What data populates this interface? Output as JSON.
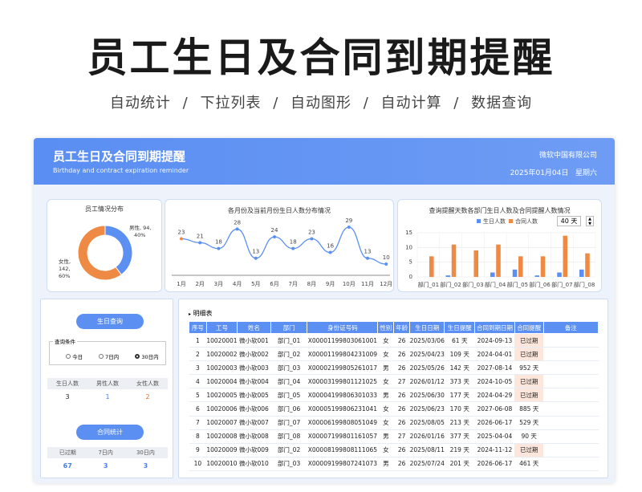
{
  "hero": {
    "title": "员工生日及合同到期提醒",
    "features": [
      "自动统计",
      "下拉列表",
      "自动图形",
      "自动计算",
      "数据查询"
    ],
    "sep": "/"
  },
  "banner": {
    "title": "员工生日及合同到期提醒",
    "subtitle": "Birthday and contract expiration reminder",
    "company": "微软中国有限公司",
    "date": "2025年01月04日",
    "weekday": "星期六"
  },
  "donut": {
    "title": "员工情况分布",
    "male_label": "男性, 94, 40%",
    "female_label": "女性, 142, 60%",
    "male": 94,
    "female": 142,
    "colors": {
      "male": "#5b8ff2",
      "female": "#ef8a45"
    }
  },
  "chart_data": [
    {
      "type": "line",
      "title": "各月份及当前月份生日人数分布情况",
      "categories": [
        "1月",
        "2月",
        "3月",
        "4月",
        "5月",
        "6月",
        "7月",
        "8月",
        "9月",
        "10月",
        "11月",
        "12月"
      ],
      "values": [
        23,
        21,
        18,
        28,
        13,
        24,
        18,
        23,
        16,
        29,
        13,
        10
      ],
      "highlight_index": 0
    },
    {
      "type": "bar",
      "title": "查询提醒天数各部门生日人数及合同提醒人数情况",
      "categories": [
        "部门_01",
        "部门_02",
        "部门_03",
        "部门_04",
        "部门_05",
        "部门_06",
        "部门_07",
        "部门_08"
      ],
      "series": [
        {
          "name": "生日人数",
          "values": [
            0,
            0.5,
            0,
            1.5,
            2.5,
            0.5,
            1.5,
            2.5
          ]
        },
        {
          "name": "合同人数",
          "values": [
            7,
            11,
            9,
            11,
            7,
            7,
            14,
            8
          ]
        }
      ],
      "yticks": [
        0,
        5,
        10,
        15
      ],
      "ylim": [
        0,
        15
      ],
      "legend": "top"
    }
  ],
  "query": {
    "days": "40 天"
  },
  "birthday": {
    "button": "生日查询",
    "group_label": "查询条件",
    "options": [
      "今日",
      "7日内",
      "30日内"
    ],
    "selected": 2,
    "headers": [
      "生日人数",
      "男性人数",
      "女性人数"
    ],
    "values": [
      "3",
      "1",
      "2"
    ]
  },
  "contract": {
    "button": "合同统计",
    "headers": [
      "已过期",
      "7日内",
      "30日内"
    ],
    "values": [
      "67",
      "3",
      "3"
    ]
  },
  "detail": {
    "title": "明细表",
    "headers": [
      "序号",
      "工号",
      "姓名",
      "部门",
      "身份证号码",
      "性别",
      "年龄",
      "生日日期",
      "生日提醒",
      "合同到期日期",
      "合同提醒",
      "备注"
    ],
    "rows": [
      [
        "1",
        "10020001",
        "微小软001",
        "部门_01",
        "X00001199803061001",
        "女",
        "26",
        "2025/03/06",
        "61 天",
        "2024-09-13",
        "已过期",
        ""
      ],
      [
        "2",
        "10020002",
        "微小软002",
        "部门_02",
        "X00001199804231009",
        "女",
        "26",
        "2025/04/23",
        "109 天",
        "2024-04-01",
        "已过期",
        ""
      ],
      [
        "3",
        "10020003",
        "微小软003",
        "部门_03",
        "X00002199805261017",
        "男",
        "26",
        "2025/05/26",
        "142 天",
        "2027-08-14",
        "952 天",
        ""
      ],
      [
        "4",
        "10020004",
        "微小软004",
        "部门_04",
        "X00003199801121025",
        "女",
        "27",
        "2026/01/12",
        "373 天",
        "2024-10-05",
        "已过期",
        ""
      ],
      [
        "5",
        "10020005",
        "微小软005",
        "部门_05",
        "X00004199806301033",
        "男",
        "26",
        "2025/06/30",
        "177 天",
        "2024-04-29",
        "已过期",
        ""
      ],
      [
        "6",
        "10020006",
        "微小软006",
        "部门_06",
        "X00005199806231041",
        "女",
        "26",
        "2025/06/23",
        "170 天",
        "2027-06-08",
        "885 天",
        ""
      ],
      [
        "7",
        "10020007",
        "微小软007",
        "部门_07",
        "X00006199808051049",
        "女",
        "26",
        "2025/08/05",
        "213 天",
        "2026-06-17",
        "529 天",
        ""
      ],
      [
        "8",
        "10020008",
        "微小软008",
        "部门_08",
        "X00007199801161057",
        "男",
        "27",
        "2026/01/16",
        "377 天",
        "2025-04-04",
        "90 天",
        ""
      ],
      [
        "9",
        "10020009",
        "微小软009",
        "部门_02",
        "X00008199808111065",
        "女",
        "26",
        "2025/08/11",
        "219 天",
        "2024-11-12",
        "已过期",
        ""
      ],
      [
        "10",
        "10020010",
        "微小软010",
        "部门_03",
        "X00009199807241073",
        "男",
        "26",
        "2025/07/24",
        "201 天",
        "2026-06-17",
        "461 天",
        ""
      ]
    ]
  }
}
